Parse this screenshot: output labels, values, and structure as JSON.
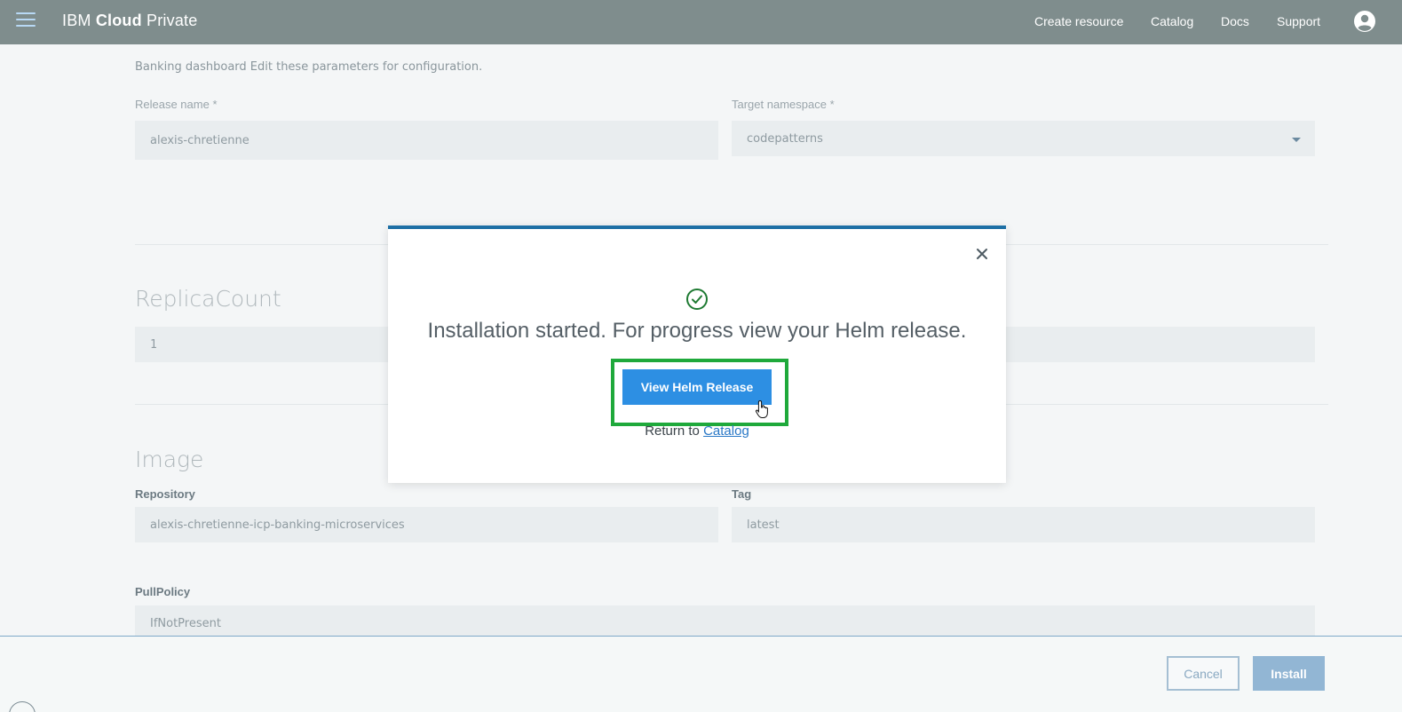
{
  "header": {
    "brand_prefix": "IBM",
    "brand_bold": "Cloud",
    "brand_suffix": "Private",
    "nav": [
      "Create resource",
      "Catalog",
      "Docs",
      "Support"
    ]
  },
  "form": {
    "intro": "Banking dashboard Edit these parameters for configuration.",
    "release_name_label": "Release name *",
    "release_name_value": "alexis-chretienne",
    "namespace_label": "Target namespace *",
    "namespace_value": "codepatterns",
    "replica_title": "ReplicaCount",
    "replica_value": "1",
    "image_title": "Image",
    "repository_label": "Repository",
    "repository_value": "alexis-chretienne-icp-banking-microservices",
    "tag_label": "Tag",
    "tag_value": "latest",
    "pullpolicy_label": "PullPolicy",
    "pullpolicy_value": "IfNotPresent"
  },
  "footer": {
    "cancel_label": "Cancel",
    "install_label": "Install"
  },
  "modal": {
    "message": "Installation started. For progress view your Helm release.",
    "primary_label": "View Helm Release",
    "return_prefix": "Return to",
    "return_link": "Catalog"
  },
  "colors": {
    "header_bg": "#7f8d8d",
    "accent_blue": "#2d8fe3",
    "modal_top_border": "#1d6fa5",
    "highlight_green": "#1fa93b",
    "success_green": "#1e7a32"
  }
}
